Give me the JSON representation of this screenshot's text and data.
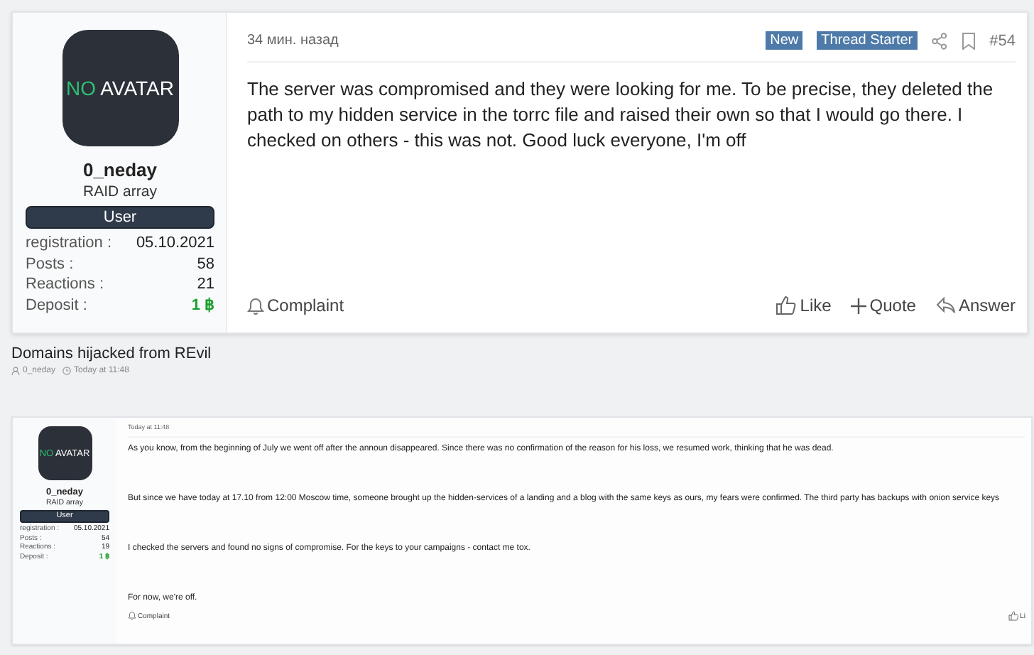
{
  "items": [
    {
      "kind": "post",
      "author": {
        "avatar_accent": "NO",
        "avatar_text": "AVATAR",
        "name": "0_neday",
        "title": "RAID array",
        "role": "User",
        "stats": [
          {
            "label": "registration :",
            "value": "05.10.2021",
            "kind": "plain"
          },
          {
            "label": "Posts :",
            "value": "58",
            "kind": "plain"
          },
          {
            "label": "Reactions :",
            "value": "21",
            "kind": "plain"
          },
          {
            "label": "Deposit :",
            "value": "1 ฿",
            "kind": "deposit"
          }
        ]
      },
      "time": "34 мин. назад",
      "badges": [
        "New",
        "Thread Starter"
      ],
      "number": "#54",
      "paragraphs": [
        "The server was compromised and they were looking for me. To be precise, they deleted the path to my hidden service in the torrc file and raised their own so that I would go there. I checked on others - this was not. Good luck everyone, I'm off"
      ],
      "actions": [
        {
          "kind": "complaint",
          "label": "Complaint"
        },
        {
          "kind": "like",
          "label": "Like"
        },
        {
          "kind": "quote",
          "label": "Quote"
        },
        {
          "kind": "answer",
          "label": "Answer"
        }
      ]
    },
    {
      "kind": "thread_header",
      "title": "Domains hijacked from REvil",
      "author": "0_neday",
      "time": "Today at 11:48"
    },
    {
      "kind": "post",
      "author": {
        "avatar_accent": "NO",
        "avatar_text": "AVATAR",
        "name": "0_neday",
        "title": "RAID array",
        "role": "User",
        "stats": [
          {
            "label": "registration :",
            "value": "05.10.2021",
            "kind": "plain"
          },
          {
            "label": "Posts :",
            "value": "54",
            "kind": "plain"
          },
          {
            "label": "Reactions :",
            "value": "19",
            "kind": "plain"
          },
          {
            "label": "Deposit :",
            "value": "1 ฿",
            "kind": "deposit"
          }
        ]
      },
      "time": "Today at 11:48",
      "paragraphs": [
        "As you know, from the beginning of July we went off after the announ disappeared. Since there was no confirmation of the reason for his loss, we resumed work, thinking that he was dead.",
        "But since we have today at 17.10 from 12:00 Moscow time, someone brought up the hidden-services of a landing and a blog with the same keys as ours, my fears were confirmed. The third party has backups with onion service keys",
        "I checked the servers and found no signs of compromise. For the keys to your campaigns - contact me tox.",
        "For now, we're off."
      ],
      "actions": [
        {
          "kind": "complaint",
          "label": "Complaint"
        },
        {
          "kind": "like",
          "label": "Li"
        }
      ]
    }
  ]
}
